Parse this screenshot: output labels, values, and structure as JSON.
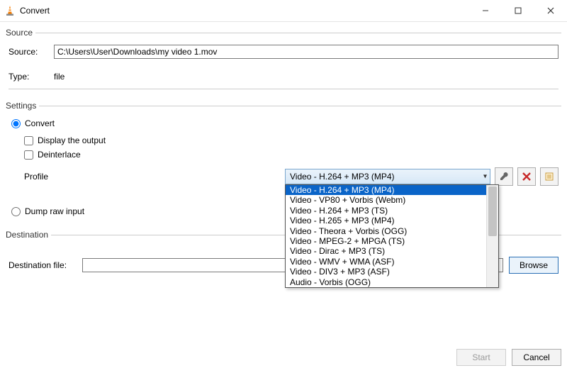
{
  "window": {
    "title": "Convert"
  },
  "source": {
    "group_label": "Source",
    "source_label": "Source:",
    "source_value": "C:\\Users\\User\\Downloads\\my video 1.mov",
    "type_label": "Type:",
    "type_value": "file"
  },
  "settings": {
    "group_label": "Settings",
    "convert_label": "Convert",
    "display_output_label": "Display the output",
    "deinterlace_label": "Deinterlace",
    "profile_label": "Profile",
    "profile_selected": "Video - H.264 + MP3 (MP4)",
    "profile_options": [
      "Video - H.264 + MP3 (MP4)",
      "Video - VP80 + Vorbis (Webm)",
      "Video - H.264 + MP3 (TS)",
      "Video - H.265 + MP3 (MP4)",
      "Video - Theora + Vorbis (OGG)",
      "Video - MPEG-2 + MPGA (TS)",
      "Video - Dirac + MP3 (TS)",
      "Video - WMV + WMA (ASF)",
      "Video - DIV3 + MP3 (ASF)",
      "Audio - Vorbis (OGG)"
    ],
    "dump_label": "Dump raw input"
  },
  "destination": {
    "group_label": "Destination",
    "file_label": "Destination file:",
    "file_value": "",
    "browse_label": "Browse"
  },
  "footer": {
    "start_label": "Start",
    "cancel_label": "Cancel"
  }
}
